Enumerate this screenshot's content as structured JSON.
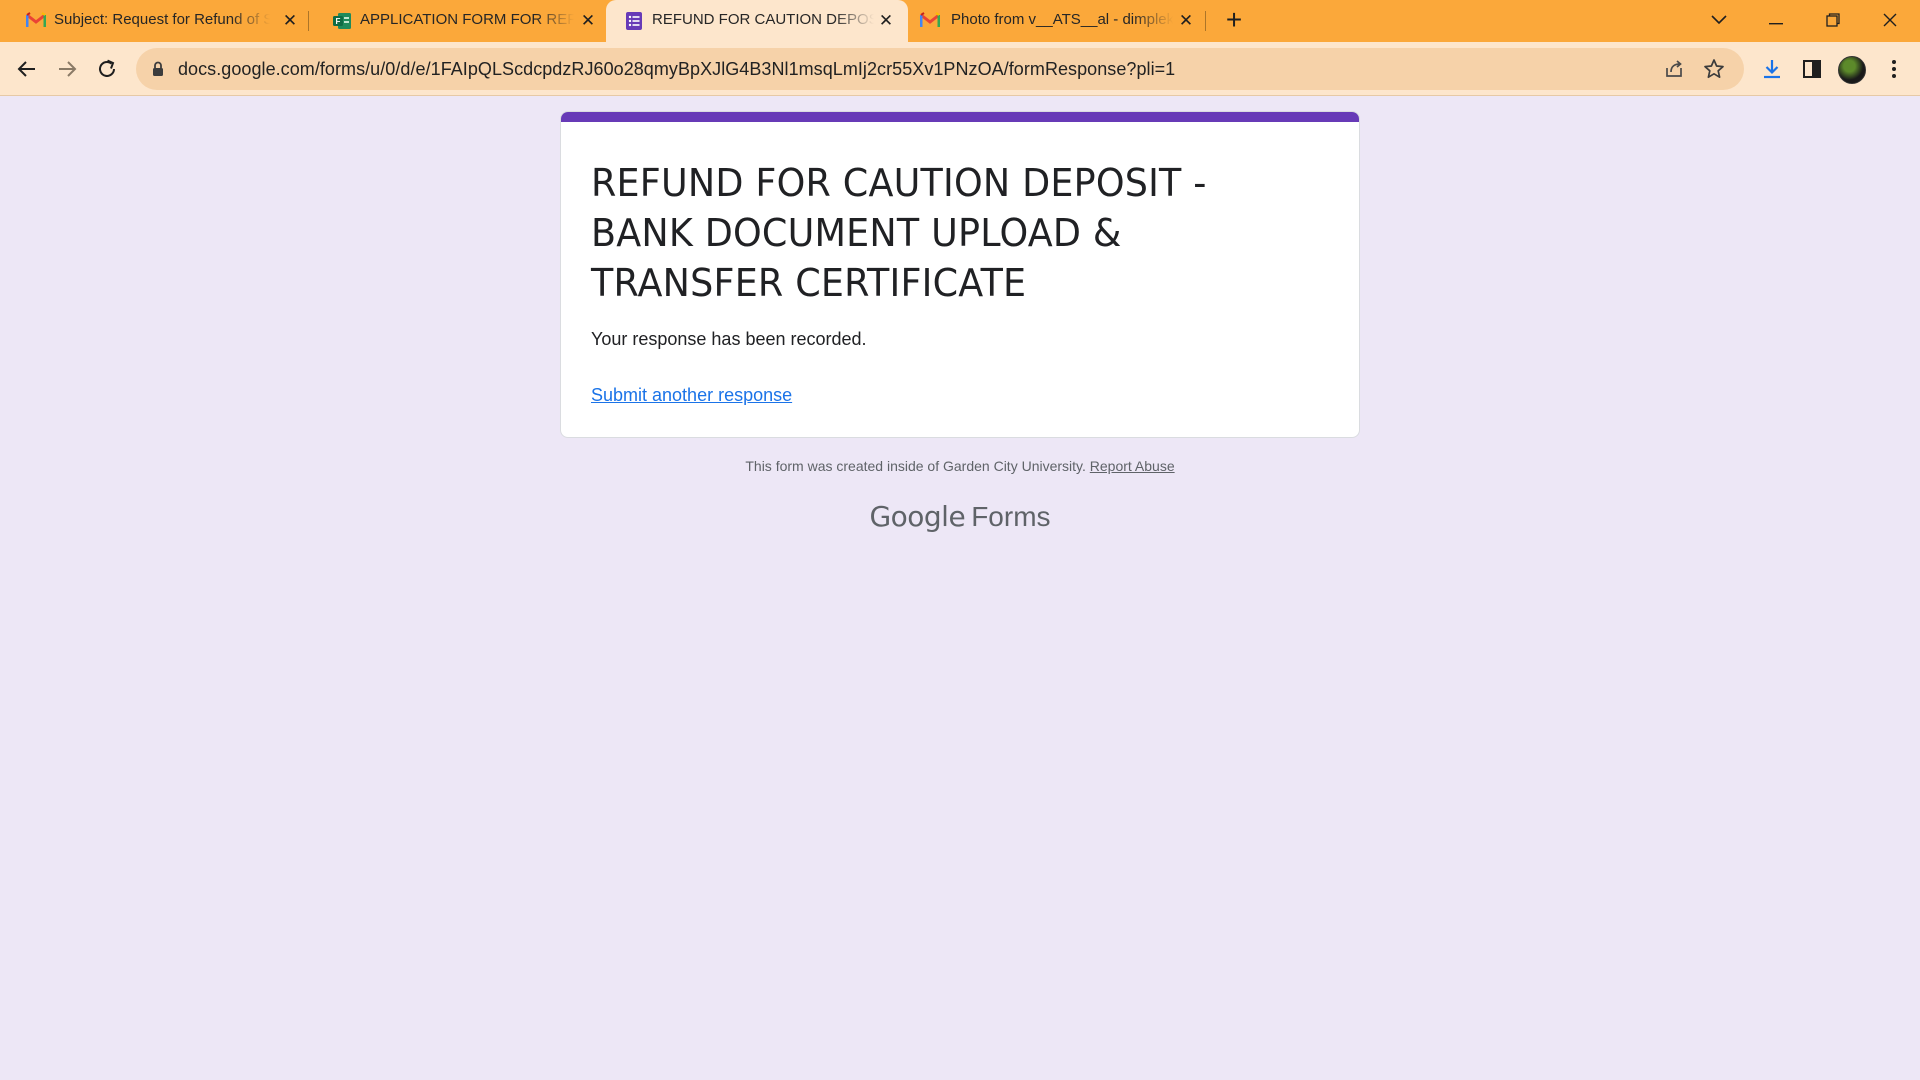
{
  "browser": {
    "tabs": [
      {
        "title": "Subject: Request for Refund of S",
        "icon": "gmail-icon"
      },
      {
        "title": "APPLICATION FORM FOR REFUND",
        "icon": "forms-excel-icon"
      },
      {
        "title": "REFUND FOR CAUTION DEPOSIT",
        "icon": "google-forms-icon",
        "active": true
      },
      {
        "title": "Photo from v__ATS__al - dimplek",
        "icon": "gmail-icon"
      }
    ],
    "url": "docs.google.com/forms/u/0/d/e/1FAIpQLScdcpdzRJ60o28qmyBpXJlG4B3Nl1msqLmIj2cr55Xv1PNzOA/formResponse?pli=1",
    "colors": {
      "tabstrip": "#fba83a",
      "toolbar": "#fde6cc",
      "omnibox": "#f6d2a9"
    }
  },
  "form": {
    "title": "REFUND FOR CAUTION DEPOSIT - BANK DOCUMENT UPLOAD & TRANSFER CERTIFICATE",
    "message": "Your response has been recorded.",
    "link": "Submit another response",
    "accent": "#673ab7"
  },
  "footer": {
    "note": "This form was created inside of Garden City University.",
    "abuse": "Report Abuse",
    "brand_google": "Google",
    "brand_forms": "Forms"
  }
}
